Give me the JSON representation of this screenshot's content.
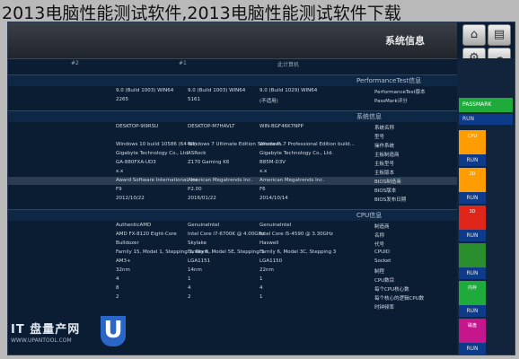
{
  "caption": "2013电脑性能测试软件,2013电脑性能测试软件下载",
  "window": {
    "title": "系统信息",
    "col_heads": [
      "#2",
      "#1",
      "此计算机"
    ]
  },
  "toolbar": {
    "icons": [
      "home-icon",
      "compare-icon",
      "settings-icon",
      "cloud-icon"
    ]
  },
  "sidebar": {
    "top_label": "PASSMARK",
    "run_label": "RUN",
    "tiles": [
      {
        "label": "CPU",
        "color": "#ff9c00"
      },
      {
        "label": "2D",
        "color": "#ff9c00"
      },
      {
        "label": "3D",
        "color": "#e0251b"
      },
      {
        "label": "",
        "color": "#2a8e2f"
      },
      {
        "label": "内存",
        "color": "#1faa3c"
      },
      {
        "label": "磁盘",
        "color": "#c5168e"
      }
    ]
  },
  "sections": [
    {
      "title": "PerformanceTest信息",
      "rows": [
        {
          "c1": "9.0 (Build 1003) WIN64",
          "c2": "9.0 (Build 1003) WIN64",
          "c3": "9.0 (Build 1029) WIN64",
          "c4": "",
          "label": "PerformanceTest版本",
          "hl": false
        },
        {
          "c1": "2265",
          "c2": "5161",
          "c3": "(不适用)",
          "c4": "",
          "label": "PassMark评分",
          "hl": false
        }
      ]
    },
    {
      "title": "系统信息",
      "rows": [
        {
          "c1": "DESKTOP-9I9RSU",
          "c2": "DESKTOP-M7HAVLT",
          "c3": "WIN-BGF46K7NPP",
          "c4": "",
          "label": "系统名称",
          "hl": false
        },
        {
          "c1": "",
          "c2": "",
          "c3": "",
          "c4": "",
          "label": "型号",
          "hl": false
        },
        {
          "c1": "Windows 10 build 10586 (64-bit)",
          "c2": "Windows 7 Ultimate Edition Service P...",
          "c3": "Windows 7 Professional Edition build...",
          "c4": "",
          "label": "操作系统",
          "hl": false
        },
        {
          "c1": "Gigabyte Technology Co., Ltd.",
          "c2": "ASRock",
          "c3": "Gigabyte Technology Co., Ltd.",
          "c4": "",
          "label": "主板制造商",
          "hl": false
        },
        {
          "c1": "GA-880FXA-UD3",
          "c2": "Z170 Gaming K6",
          "c3": "B85M-D3V",
          "c4": "",
          "label": "主板型号",
          "hl": false
        },
        {
          "c1": "x.x",
          "c2": "",
          "c3": "x.x",
          "c4": "",
          "label": "主板版本",
          "hl": false
        },
        {
          "c1": "Award Software International, Inc.",
          "c2": "American Megatrends Inc.",
          "c3": "American Megatrends Inc.",
          "c4": "",
          "label": "BIOS制造商",
          "hl": true
        },
        {
          "c1": "F9",
          "c2": "P2.00",
          "c3": "F6",
          "c4": "",
          "label": "BIOS版本",
          "hl": false
        },
        {
          "c1": "2012/10/22",
          "c2": "2016/01/22",
          "c3": "2014/10/14",
          "c4": "",
          "label": "BIOS发布日期",
          "hl": false
        }
      ]
    },
    {
      "title": "CPU信息",
      "rows": [
        {
          "c1": "AuthenticAMD",
          "c2": "GenuineIntel",
          "c3": "GenuineIntel",
          "c4": "",
          "label": "制造商",
          "hl": false
        },
        {
          "c1": "AMD FX-8120 Eight-Core",
          "c2": "Intel Core i7-6700K @ 4.00GHz",
          "c3": "Intel Core i5-4590 @ 3.30GHz",
          "c4": "",
          "label": "名称",
          "hl": false
        },
        {
          "c1": "Bulldozer",
          "c2": "Skylake",
          "c3": "Haswell",
          "c4": "",
          "label": "代号",
          "hl": false
        },
        {
          "c1": "Family 15, Model 1, Stepping 2, Revis...",
          "c2": "Family 6, Model 5E, Stepping 3",
          "c3": "Family 6, Model 3C, Stepping 3",
          "c4": "",
          "label": "CPUID",
          "hl": false
        },
        {
          "c1": "AM3+",
          "c2": "LGA1151",
          "c3": "LGA1150",
          "c4": "",
          "label": "Socket",
          "hl": false
        },
        {
          "c1": "32nm",
          "c2": "14nm",
          "c3": "22nm",
          "c4": "",
          "label": "制程",
          "hl": false
        },
        {
          "c1": "4",
          "c2": "1",
          "c3": "1",
          "c4": "",
          "label": "CPU数目",
          "hl": false
        },
        {
          "c1": "8",
          "c2": "4",
          "c3": "4",
          "c4": "",
          "label": "每个CPU核心数",
          "hl": false
        },
        {
          "c1": "2",
          "c2": "2",
          "c3": "1",
          "c4": "",
          "label": "每个核心的逻辑CPU数",
          "hl": false
        },
        {
          "c1": "",
          "c2": "",
          "c3": "",
          "c4": "",
          "label": "时钟频率",
          "hl": false
        }
      ]
    }
  ],
  "watermark": {
    "text": "IT 盘量产网",
    "url": "WWW.UPANTOOL.COM",
    "logo": "U"
  }
}
